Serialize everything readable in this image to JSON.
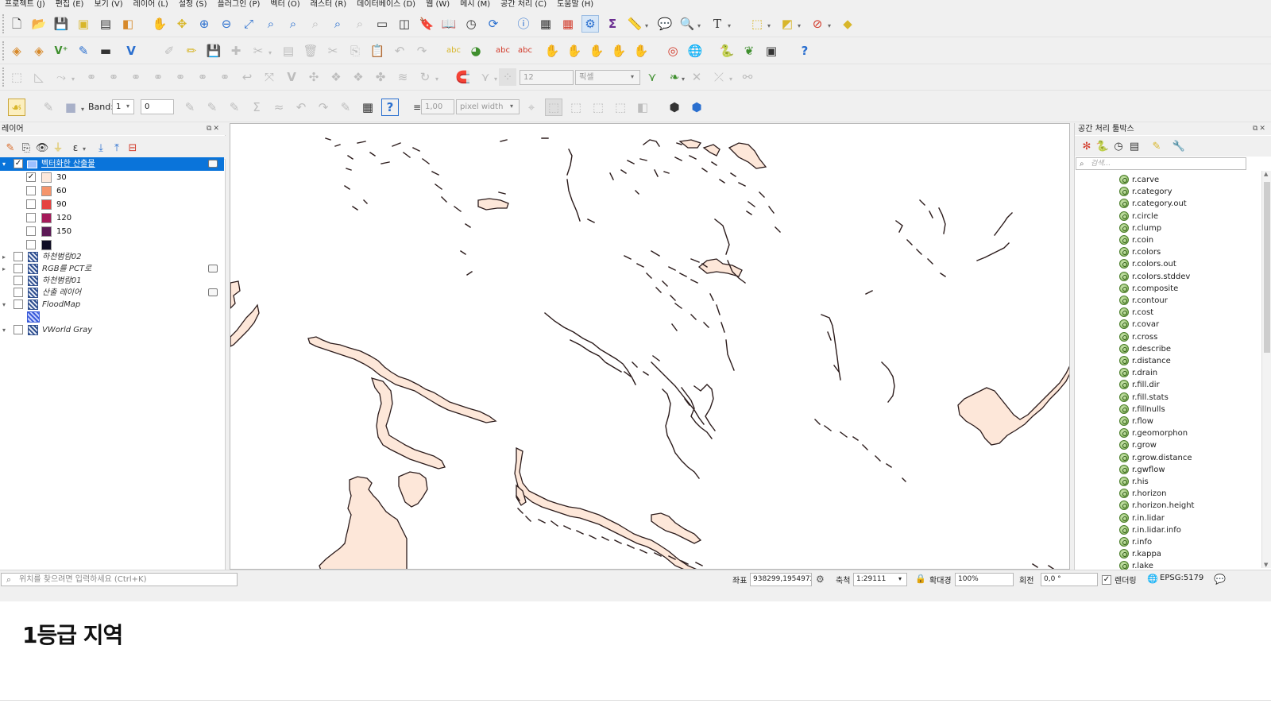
{
  "menu": [
    "프로젝트 (J)",
    "편집 (E)",
    "보기 (V)",
    "레이어 (L)",
    "설정 (S)",
    "플러그인 (P)",
    "벡터 (O)",
    "래스터 (R)",
    "데이터베이스 (D)",
    "웹 (W)",
    "메시 (M)",
    "공간 처리 (C)",
    "도움말 (H)"
  ],
  "toolbar": {
    "snap_tolerance": "12",
    "snap_unit": "픽셀",
    "band_label": "Band:",
    "band_value": "1",
    "band_input": "0",
    "line_width": "1,00",
    "width_unit": "pixel width"
  },
  "layers_panel": {
    "title": "레이어",
    "layers": [
      {
        "name": "벡터화한 산출물",
        "checked": true,
        "selected": true
      },
      {
        "name": "하천범람02",
        "checked": false
      },
      {
        "name": "RGB를 PCT로",
        "checked": false
      },
      {
        "name": "하천범람01",
        "checked": false
      },
      {
        "name": "산출 레이어",
        "checked": false
      },
      {
        "name": "FloodMap",
        "checked": false
      },
      {
        "name": "VWorld Gray",
        "checked": false
      }
    ],
    "legend": [
      {
        "label": "30",
        "color": "#fde9dc",
        "checked": true
      },
      {
        "label": "60",
        "color": "#f5956c",
        "checked": false
      },
      {
        "label": "90",
        "color": "#e54241",
        "checked": false
      },
      {
        "label": "120",
        "color": "#a51a5a",
        "checked": false
      },
      {
        "label": "150",
        "color": "#5c1a56",
        "checked": false
      },
      {
        "label": "",
        "color": "#0f0d24",
        "checked": false
      }
    ]
  },
  "toolbox": {
    "title": "공간 처리 툴박스",
    "search_placeholder": "검색...",
    "items": [
      "r.carve",
      "r.category",
      "r.category.out",
      "r.circle",
      "r.clump",
      "r.coin",
      "r.colors",
      "r.colors.out",
      "r.colors.stddev",
      "r.composite",
      "r.contour",
      "r.cost",
      "r.covar",
      "r.cross",
      "r.describe",
      "r.distance",
      "r.drain",
      "r.fill.dir",
      "r.fill.stats",
      "r.fillnulls",
      "r.flow",
      "r.geomorphon",
      "r.grow",
      "r.grow.distance",
      "r.gwflow",
      "r.his",
      "r.horizon",
      "r.horizon.height",
      "r.in.lidar",
      "r.in.lidar.info",
      "r.info",
      "r.kappa",
      "r.lake"
    ]
  },
  "statusbar": {
    "locator_placeholder": "위치를 찾으려면 입력하세요 (Ctrl+K)",
    "coord_label": "좌표",
    "coord_value": "938299,1954972",
    "scale_label": "축척",
    "scale_value": "1:29111",
    "magnifier_label": "확대경",
    "magnifier_value": "100%",
    "rotation_label": "회전",
    "rotation_value": "0,0 °",
    "render_label": "렌더링",
    "crs": "EPSG:5179"
  },
  "caption": "1등급 지역",
  "colors": {
    "flood_fill": "#fde7d9",
    "flood_stroke": "#2b1b1b",
    "selection": "#0a74da"
  }
}
